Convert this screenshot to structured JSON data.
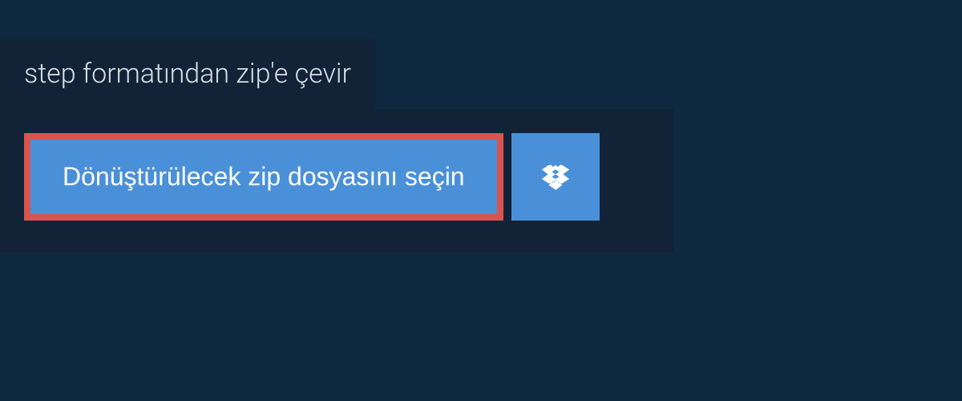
{
  "header": {
    "title": "step formatından zip'e çevir"
  },
  "actions": {
    "select_file_label": "Dönüştürülecek zip dosyasını seçin"
  },
  "colors": {
    "page_bg": "#0f2940",
    "panel_bg": "#122338",
    "button_bg": "#4a90d9",
    "highlight_border": "#d9544f",
    "text_light": "#ffffff",
    "text_muted": "#d9dfe5"
  }
}
